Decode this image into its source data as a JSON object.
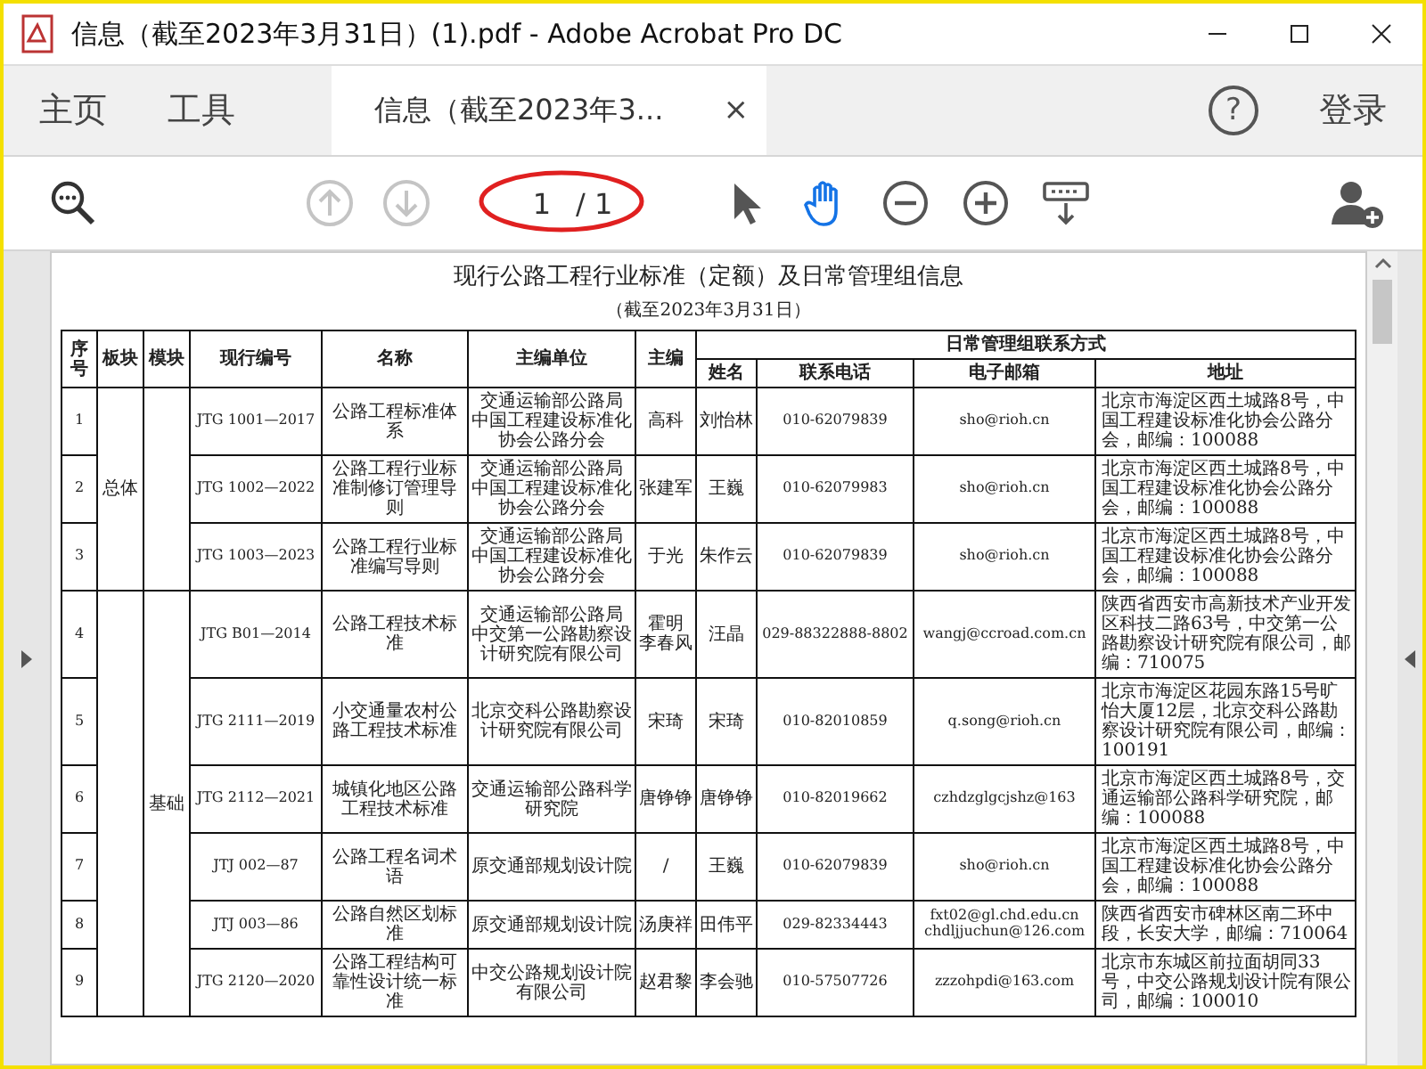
{
  "window": {
    "title": "信息（截至2023年3月31日）(1).pdf - Adobe Acrobat Pro DC"
  },
  "tabs": [
    {
      "label": "主页",
      "selected": false
    },
    {
      "label": "工具",
      "selected": false
    },
    {
      "label": "信息（截至2023年3...",
      "selected": true,
      "close": "×"
    }
  ],
  "help": "?",
  "sign_in": "登录",
  "toolbar": {
    "nav": [
      {
        "kind": "prev-page",
        "disabled": true
      },
      {
        "kind": "next-page",
        "disabled": true
      }
    ],
    "page_field": {
      "value": "1",
      "total": "/ 1"
    },
    "tools": [
      {
        "kind": "select",
        "selected": false
      },
      {
        "kind": "hand",
        "selected": true
      },
      {
        "kind": "zoom-out",
        "selected": false
      },
      {
        "kind": "zoom-in",
        "selected": false
      },
      {
        "kind": "read-mode",
        "selected": false
      }
    ]
  },
  "document": {
    "title": "现行公路工程行业标准（定额）及日常管理组信息",
    "subtitle": "（截至2023年3月31日）",
    "table": {
      "columns": [
        "序号",
        "板块",
        "模块",
        "现行编号",
        "名称",
        "主编单位",
        "主编"
      ],
      "contact_group": {
        "label": "日常管理组联系方式",
        "columns": [
          "姓名",
          "联系电话",
          "电子邮箱",
          "地址"
        ]
      },
      "sections": [
        {
          "board": "总体",
          "rows": [
            {
              "no": "1",
              "code": "JTG 1001—2017",
              "name": "公路工程标准体系",
              "unit": [
                "交通运输部公路局",
                "中国工程建设标准化协会公路分会"
              ],
              "editor": [
                "高科"
              ],
              "contact": "刘怡林",
              "phone": "010-62079839",
              "email": "sho@rioh.cn",
              "address": "北京市海淀区西土城路8号，中国工程建设标准化协会公路分会，邮编：100088"
            },
            {
              "no": "2",
              "code": "JTG 1002—2022",
              "name": "公路工程行业标准制修订管理导则",
              "unit": [
                "交通运输部公路局",
                "中国工程建设标准化协会公路分会"
              ],
              "editor": [
                "张建军"
              ],
              "contact": "王巍",
              "phone": "010-62079983",
              "email": "sho@rioh.cn",
              "address": "北京市海淀区西土城路8号，中国工程建设标准化协会公路分会，邮编：100088"
            },
            {
              "no": "3",
              "code": "JTG 1003—2023",
              "name": "公路工程行业标准编写导则",
              "unit": [
                "交通运输部公路局",
                "中国工程建设标准化协会公路分会"
              ],
              "editor": [
                "于光"
              ],
              "contact": "朱作云",
              "phone": "010-62079839",
              "email": "sho@rioh.cn",
              "address": "北京市海淀区西土城路8号，中国工程建设标准化协会公路分会，邮编：100088"
            }
          ]
        },
        {
          "module": "基础",
          "rows": [
            {
              "no": "4",
              "code": "JTG B01—2014",
              "name": "公路工程技术标准",
              "unit": [
                "交通运输部公路局",
                "中交第一公路勘察设计研究院有限公司"
              ],
              "editor": [
                "霍明",
                "李春风"
              ],
              "contact": "汪晶",
              "phone": "029-88322888-8802",
              "email": "wangj@ccroad.com.cn",
              "address": "陕西省西安市高新技术产业开发区科技二路63号，中交第一公路勘察设计研究院有限公司，邮编：710075"
            },
            {
              "no": "5",
              "code": "JTG 2111—2019",
              "name": "小交通量农村公路工程技术标准",
              "unit": [
                "北京交科公路勘察设计研究院有限公司"
              ],
              "editor": [
                "宋琦"
              ],
              "contact": "宋琦",
              "phone": "010-82010859",
              "email": "q.song@rioh.cn",
              "address": "北京市海淀区花园东路15号旷怡大厦12层，北京交科公路勘察设计研究院有限公司，邮编：100191"
            },
            {
              "no": "6",
              "code": "JTG 2112—2021",
              "name": "城镇化地区公路工程技术标准",
              "unit": [
                "交通运输部公路科学研究院"
              ],
              "editor": [
                "唐铮铮"
              ],
              "contact": "唐铮铮",
              "phone": "010-82019662",
              "email": "czhdzglgcjshz@163",
              "address": "北京市海淀区西土城路8号，交通运输部公路科学研究院，邮编：100088"
            },
            {
              "no": "7",
              "code": "JTJ 002—87",
              "name": "公路工程名词术语",
              "unit": [
                "原交通部规划设计院"
              ],
              "editor": [
                "/"
              ],
              "contact": "王巍",
              "phone": "010-62079839",
              "email": "sho@rioh.cn",
              "address": "北京市海淀区西土城路8号，中国工程建设标准化协会公路分会，邮编：100088"
            },
            {
              "no": "8",
              "code": "JTJ 003—86",
              "name": "公路自然区划标准",
              "unit": [
                "原交通部规划设计院"
              ],
              "editor": [
                "汤庚祥"
              ],
              "contact": "田伟平",
              "phone": "029-82334443",
              "email": [
                "fxt02@gl.chd.edu.cn",
                "chdljjuchun@126.com"
              ],
              "address": "陕西省西安市碑林区南二环中段，长安大学，邮编：710064"
            },
            {
              "no": "9",
              "code": "JTG 2120—2020",
              "name": "公路工程结构可靠性设计统一标准",
              "unit": [
                "中交公路规划设计院有限公司"
              ],
              "editor": [
                "赵君黎"
              ],
              "contact": "李会驰",
              "phone": "010-57507726",
              "email": "zzzohpdi@163.com",
              "address": "北京市东城区前拉面胡同33号，中交公路规划设计院有限公司，邮编：100010"
            }
          ]
        }
      ]
    }
  }
}
